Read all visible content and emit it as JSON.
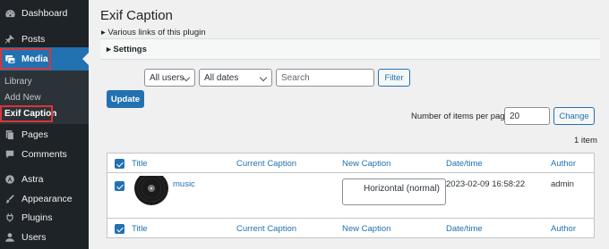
{
  "sidebar": {
    "items": [
      {
        "label": "Dashboard",
        "icon": "dashboard-icon"
      },
      {
        "label": "Posts",
        "icon": "pin-icon"
      },
      {
        "label": "Media",
        "icon": "media-icon"
      },
      {
        "label": "Pages",
        "icon": "pages-icon"
      },
      {
        "label": "Comments",
        "icon": "comments-icon"
      },
      {
        "label": "Astra",
        "icon": "astra-icon"
      },
      {
        "label": "Appearance",
        "icon": "brush-icon"
      },
      {
        "label": "Plugins",
        "icon": "plugin-icon"
      },
      {
        "label": "Users",
        "icon": "users-icon"
      }
    ],
    "submenu": [
      "Library",
      "Add New",
      "Exif Caption"
    ]
  },
  "page": {
    "title": "Exif Caption",
    "plugin_links": "Various links of this plugin",
    "settings": "Settings"
  },
  "filters": {
    "users": "All users",
    "dates": "All dates",
    "search_placeholder": "Search",
    "filter_button": "Filter"
  },
  "update_button": "Update",
  "pagination": {
    "per_page_label": "Number of items per page:",
    "per_page_value": "20",
    "change_button": "Change",
    "count": "1 item"
  },
  "table": {
    "columns": [
      "Title",
      "Current Caption",
      "New Caption",
      "Date/time",
      "Author"
    ],
    "rows": [
      {
        "title": "music",
        "current_caption": "",
        "new_caption": "Horizontal (normal)",
        "datetime": "2023-02-09 16:58:22",
        "author": "admin"
      }
    ]
  },
  "colors": {
    "accent": "#2271b1",
    "sidebar": "#1d2327",
    "highlight": "#d63638"
  }
}
